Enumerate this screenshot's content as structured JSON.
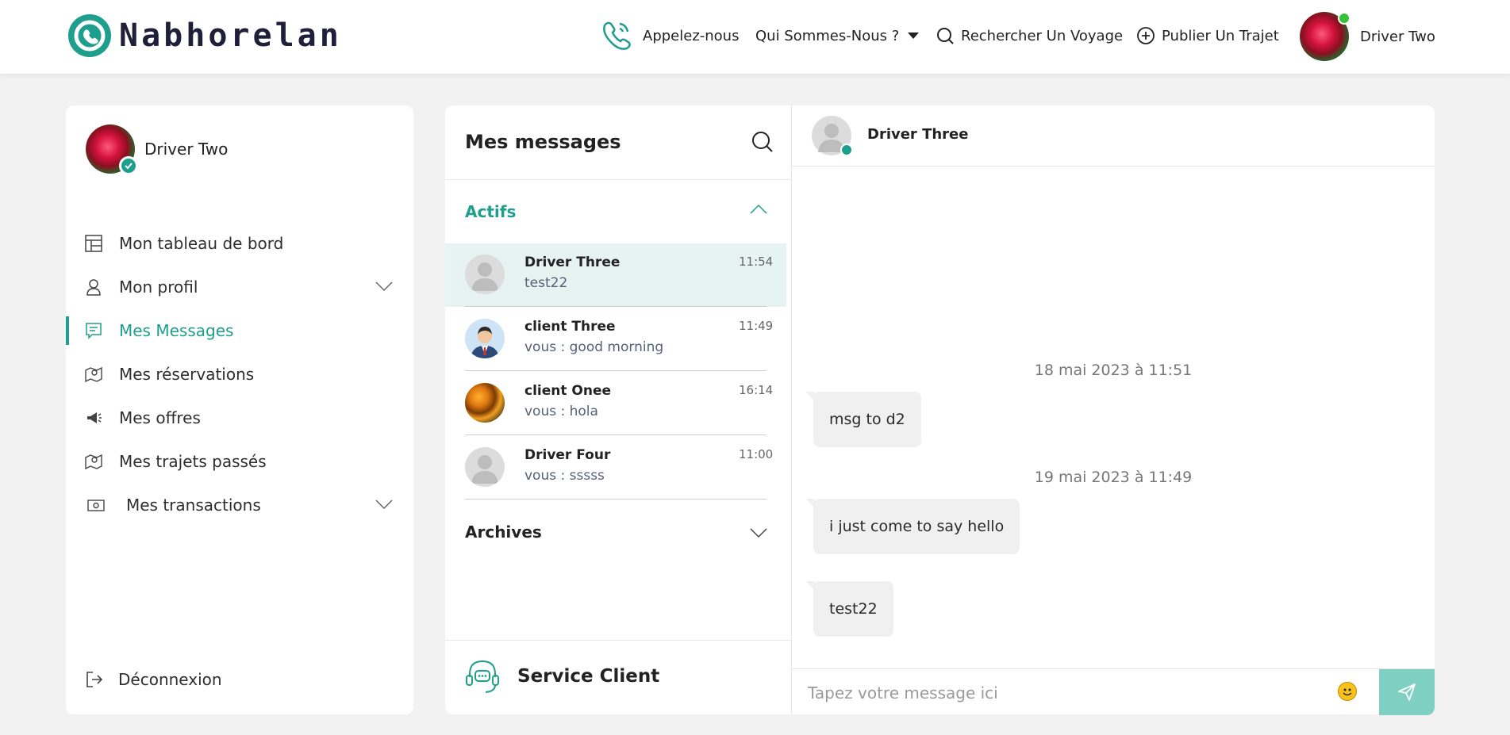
{
  "header": {
    "brand": "Nabhorelan",
    "nav": {
      "call": "Appelez-nous",
      "about": "Qui Sommes-Nous ?",
      "search": "Rechercher Un Voyage",
      "publish": "Publier Un Trajet"
    },
    "user_name": "Driver Two"
  },
  "sidebar": {
    "user_name": "Driver Two",
    "items": [
      {
        "label": "Mon tableau de bord",
        "icon": "dashboard-icon"
      },
      {
        "label": "Mon profil",
        "icon": "user-icon"
      },
      {
        "label": "Mes Messages",
        "icon": "message-icon",
        "active": true
      },
      {
        "label": "Mes réservations",
        "icon": "map-pin-icon"
      },
      {
        "label": "Mes offres",
        "icon": "megaphone-icon"
      },
      {
        "label": "Mes trajets passés",
        "icon": "map-pin-icon"
      },
      {
        "label": "Mes transactions",
        "icon": "cash-icon"
      }
    ],
    "logout": "Déconnexion"
  },
  "conversations": {
    "title": "Mes messages",
    "active_section": "Actifs",
    "archive_section": "Archives",
    "items": [
      {
        "name": "Driver Three",
        "preview": "test22",
        "time": "11:54"
      },
      {
        "name": "client Three",
        "preview": "vous : good morning",
        "time": "11:49"
      },
      {
        "name": "client Onee",
        "preview": "vous : hola",
        "time": "16:14"
      },
      {
        "name": "Driver Four",
        "preview": "vous : sssss",
        "time": "11:00"
      }
    ],
    "service": "Service Client"
  },
  "chat": {
    "contact": "Driver Three",
    "days": [
      "18 mai 2023 à 11:51",
      "19 mai 2023 à 11:49"
    ],
    "messages": [
      "msg to d2",
      "i just come to say hello",
      "test22"
    ],
    "input_placeholder": "Tapez votre message ici"
  },
  "colors": {
    "accent": "#1e9e8c",
    "send_button": "#7fcfc3",
    "selected_row": "#e6f3f1"
  }
}
